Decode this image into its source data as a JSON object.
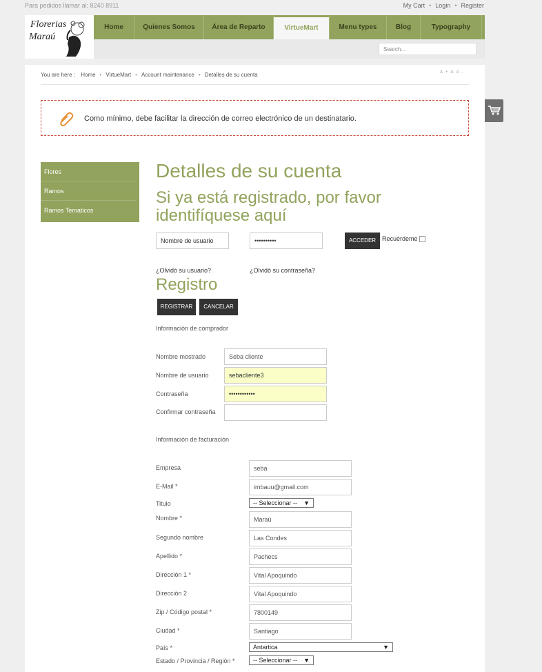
{
  "topbar": {
    "phone": "Para pedidos llamar al: 8240 8911",
    "links": [
      "My Cart",
      "Login",
      "Register"
    ]
  },
  "logo": {
    "line1": "Florerias",
    "line2": "Maraú"
  },
  "nav": [
    {
      "label": "Home"
    },
    {
      "label": "Quienes Somos"
    },
    {
      "label": "Área de Reparto"
    },
    {
      "label": "VirtueMart"
    },
    {
      "label": "Menu types"
    },
    {
      "label": "Blog"
    },
    {
      "label": "Typography"
    }
  ],
  "search": {
    "placeholder": "Search..."
  },
  "breadcrumb": {
    "prefix": "You are here :",
    "items": [
      "Home",
      "VirtueMart",
      "Account maintenance",
      "Detalles de su cuenta"
    ]
  },
  "fontsize": [
    "A+",
    "A",
    "A-"
  ],
  "notice": {
    "message": "Como mínimo, debe facilitar la dirección de correo electrónico de un destinatario."
  },
  "sidebar": {
    "items": [
      "Flores",
      "Ramos",
      "Ramos Tematicos"
    ]
  },
  "page": {
    "title": "Detalles de su cuenta",
    "login_heading": "Si ya está registrado, por favor identifíquese aquí",
    "username_value": "Nombre de usuario",
    "password_value": "••••••••••",
    "login_button": "ACCEDER",
    "remember_label": "Recuérdeme",
    "forgot_user": "¿Olvidó su usuario?",
    "forgot_pass": "¿Olvidó su contraseña?",
    "register_heading": "Registro",
    "register_button": "REGISTRAR",
    "cancel_button": "CANCELAR"
  },
  "buyer": {
    "section": "Información de comprador",
    "fields": [
      {
        "label": "Nombre mostrado",
        "value": "Seba cliente"
      },
      {
        "label": "Nombre de usuario",
        "value": "sebacliente3"
      },
      {
        "label": "Contraseña",
        "value": "••••••••••••"
      },
      {
        "label": "Confirmar contraseña",
        "value": ""
      }
    ]
  },
  "billing": {
    "section": "Información de facturación",
    "fields": [
      {
        "label": "Empresa",
        "value": "seba"
      },
      {
        "label": "E-Mail *",
        "value": "imbauu@gmail.com"
      },
      {
        "label": "Titulo",
        "value": "-- Seleccionar --"
      },
      {
        "label": "Nombre *",
        "value": "Maraú"
      },
      {
        "label": "Segundo nombre",
        "value": "Las Condes"
      },
      {
        "label": "Apellido *",
        "value": "Pachecs"
      },
      {
        "label": "Dirección 1 *",
        "value": "Vital Apoquindo"
      },
      {
        "label": "Dirección 2",
        "value": "Vital Apoquindo"
      },
      {
        "label": "Zip / Código postal *",
        "value": "7800149"
      },
      {
        "label": "Ciudad *",
        "value": "Santiago"
      },
      {
        "label": "País *",
        "value": "Antartica"
      },
      {
        "label": "Estado / Provincia / Región *",
        "value": "-- Seleccionar --"
      }
    ]
  }
}
